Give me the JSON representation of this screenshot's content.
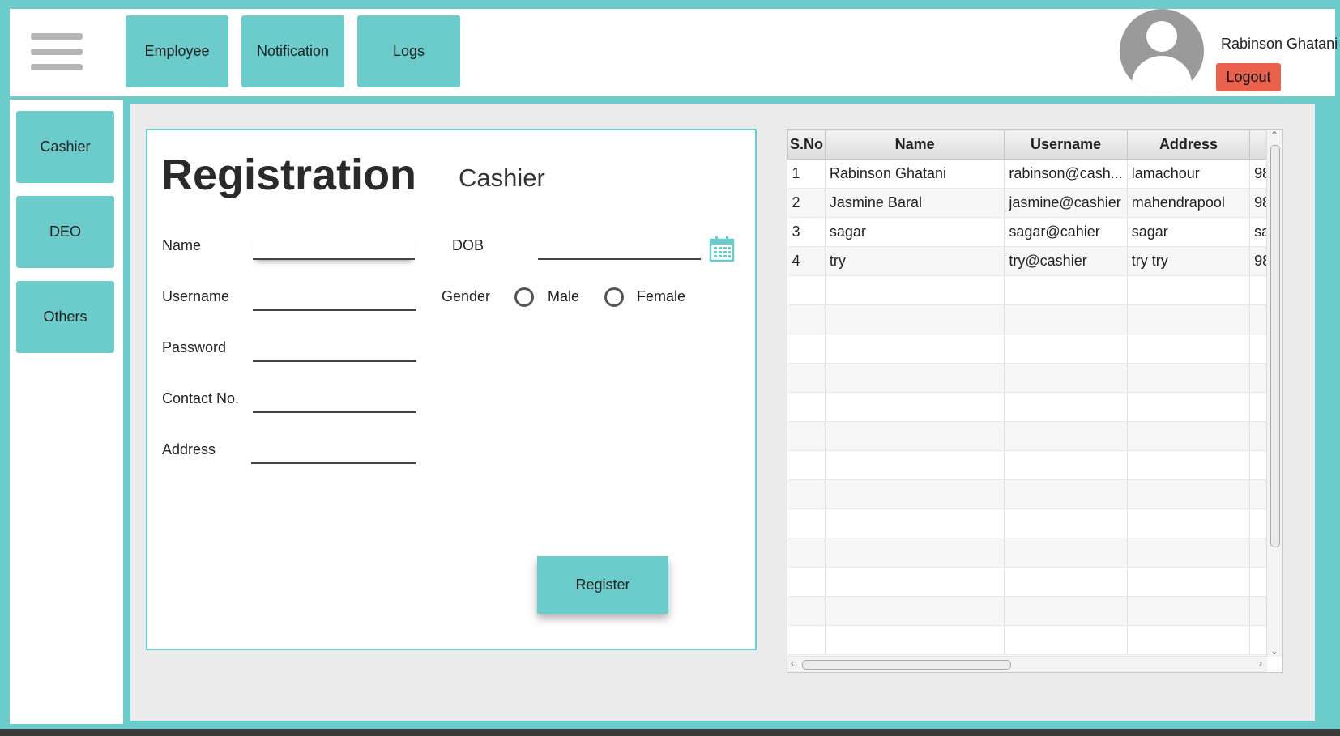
{
  "topnav": {
    "buttons": [
      "Employee",
      "Notification",
      "Logs"
    ]
  },
  "user": {
    "name": "Rabinson Ghatani",
    "logout_label": "Logout"
  },
  "sidebar": {
    "items": [
      "Cashier",
      "DEO",
      "Others"
    ]
  },
  "form": {
    "title": "Registration",
    "subtitle": "Cashier",
    "labels": {
      "name": "Name",
      "dob": "DOB",
      "username": "Username",
      "gender": "Gender",
      "password": "Password",
      "contact": "Contact No.",
      "address": "Address"
    },
    "gender_options": [
      "Male",
      "Female"
    ],
    "register_label": "Register"
  },
  "table": {
    "columns": [
      "S.No",
      "Name",
      "Username",
      "Address",
      ""
    ],
    "rows": [
      [
        "1",
        "Rabinson Ghatani",
        "rabinson@cash...",
        "lamachour",
        "98"
      ],
      [
        "2",
        "Jasmine Baral",
        "jasmine@cashier",
        "mahendrapool",
        "98"
      ],
      [
        "3",
        "sagar",
        "sagar@cahier",
        "sagar",
        "sa"
      ],
      [
        "4",
        "try",
        "try@cashier",
        "try try",
        "98"
      ]
    ]
  },
  "colors": {
    "accent": "#6ccccb",
    "logout": "#e9604c"
  }
}
